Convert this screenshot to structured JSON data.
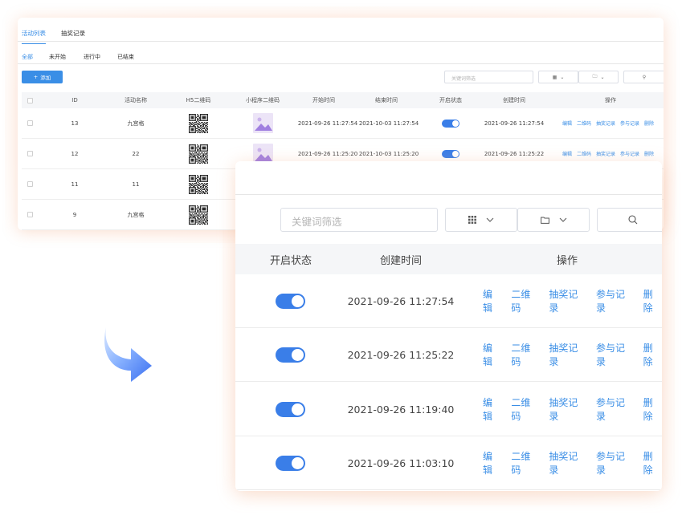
{
  "back_panel": {
    "main_tabs": [
      "活动列表",
      "抽奖记录"
    ],
    "status_tabs": [
      "全部",
      "未开始",
      "进行中",
      "已结束"
    ],
    "add_button": "添加",
    "search_placeholder": "关键词筛选",
    "columns": [
      "ID",
      "活动名称",
      "H5二维码",
      "小程序二维码",
      "开始时间",
      "结束时间",
      "开启状态",
      "创建时间",
      "操作"
    ],
    "rows": [
      {
        "id": "13",
        "name": "九宫格",
        "start": "2021-09-26 11:27:54",
        "end": "2021-10-03 11:27:54",
        "created": "2021-09-26 11:27:54"
      },
      {
        "id": "12",
        "name": "22",
        "start": "2021-09-26 11:25:20",
        "end": "2021-10-03 11:25:20",
        "created": "2021-09-26 11:25:22"
      },
      {
        "id": "11",
        "name": "11"
      },
      {
        "id": "9",
        "name": "九宫格"
      }
    ],
    "actions": [
      "编辑",
      "二维码",
      "抽奖记录",
      "参与记录",
      "删除"
    ]
  },
  "front_panel": {
    "search_placeholder": "关键词筛选",
    "columns": [
      "开启状态",
      "创建时间",
      "操作"
    ],
    "rows": [
      {
        "status_on": true,
        "created": "2021-09-26 11:27:54"
      },
      {
        "status_on": true,
        "created": "2021-09-26 11:25:22"
      },
      {
        "status_on": true,
        "created": "2021-09-26 11:19:40"
      },
      {
        "status_on": true,
        "created": "2021-09-26 11:03:10"
      }
    ],
    "actions": [
      "编辑",
      "二维码",
      "抽奖记录",
      "参与记录",
      "删除"
    ]
  },
  "colors": {
    "accent": "#3a8ee6",
    "toggle": "#3a7ee8",
    "arrow_start": "#a9c9ff",
    "arrow_end": "#3a6ff0"
  },
  "icons": {
    "grid": "grid-icon",
    "folder": "folder-icon",
    "search": "search-icon",
    "chevron": "chevron-down-icon",
    "plus": "plus-icon"
  }
}
